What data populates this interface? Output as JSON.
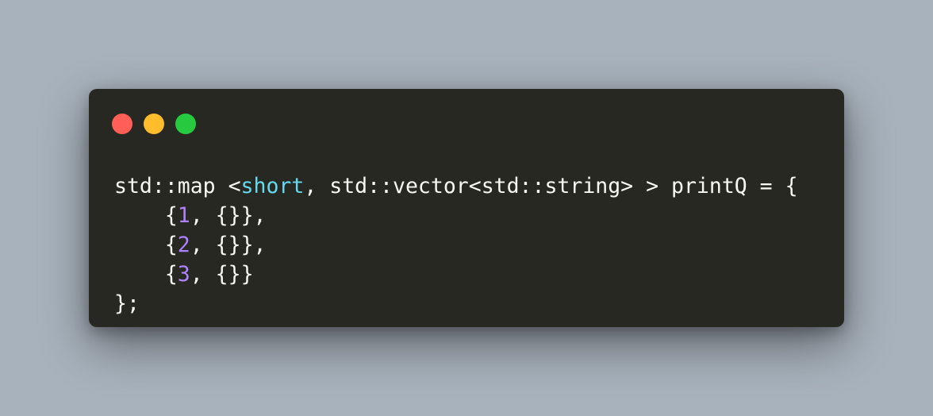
{
  "window": {
    "controls": {
      "close_color": "#ff5f56",
      "minimize_color": "#ffbd2e",
      "maximize_color": "#27c93f"
    }
  },
  "code": {
    "line1": {
      "before_type": "std::map <",
      "type": "short",
      "after_type": ", std::vector<std::string> > printQ = {"
    },
    "line2": {
      "indent": "    ",
      "open": "{",
      "num": "1",
      "close": ", {}},"
    },
    "line3": {
      "indent": "    ",
      "open": "{",
      "num": "2",
      "close": ", {}},"
    },
    "line4": {
      "indent": "    ",
      "open": "{",
      "num": "3",
      "close": ", {}}"
    },
    "line5": {
      "text": "};"
    }
  },
  "colors": {
    "background": "#a8b2bc",
    "editor_background": "#272822",
    "text": "#f8f8f2",
    "type_keyword": "#66d9ef",
    "number_literal": "#ae81ff"
  }
}
